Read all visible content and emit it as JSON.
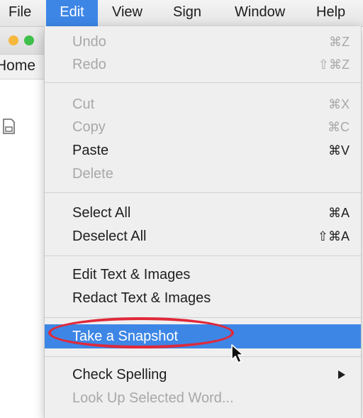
{
  "menubar": {
    "items": [
      "File",
      "Edit",
      "View",
      "Sign",
      "Window",
      "Help"
    ],
    "active": "Edit"
  },
  "background_window": {
    "tab_label": "Home"
  },
  "edit_menu": {
    "groups": [
      [
        {
          "label": "Undo",
          "shortcut": "⌘Z",
          "enabled": false
        },
        {
          "label": "Redo",
          "shortcut": "⇧⌘Z",
          "enabled": false
        }
      ],
      [
        {
          "label": "Cut",
          "shortcut": "⌘X",
          "enabled": false
        },
        {
          "label": "Copy",
          "shortcut": "⌘C",
          "enabled": false
        },
        {
          "label": "Paste",
          "shortcut": "⌘V",
          "enabled": true
        },
        {
          "label": "Delete",
          "shortcut": "",
          "enabled": false
        }
      ],
      [
        {
          "label": "Select All",
          "shortcut": "⌘A",
          "enabled": true
        },
        {
          "label": "Deselect All",
          "shortcut": "⇧⌘A",
          "enabled": true
        }
      ],
      [
        {
          "label": "Edit Text & Images",
          "shortcut": "",
          "enabled": true
        },
        {
          "label": "Redact Text & Images",
          "shortcut": "",
          "enabled": true
        }
      ],
      [
        {
          "label": "Take a Snapshot",
          "shortcut": "",
          "enabled": true,
          "highlighted": true,
          "circled": true
        }
      ],
      [
        {
          "label": "Check Spelling",
          "shortcut": "",
          "enabled": true,
          "submenu": true
        },
        {
          "label": "Look Up Selected Word...",
          "shortcut": "",
          "enabled": false
        }
      ]
    ]
  },
  "colors": {
    "highlight": "#3d86e6",
    "annotation_ring": "#e0293a",
    "disabled_text": "#a8a8a8"
  }
}
